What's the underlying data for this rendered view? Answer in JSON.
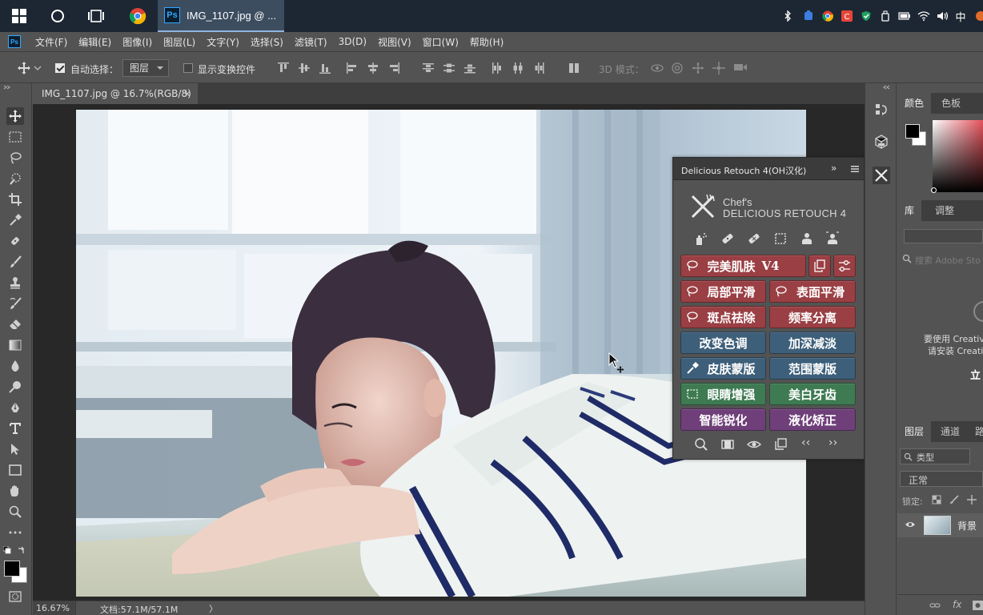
{
  "taskbar": {
    "ps_task_title": "IMG_1107.jpg @ ...",
    "ps_logo": "Ps",
    "ime_label": "中"
  },
  "menubar": {
    "logo": "Ps",
    "items": [
      "文件(F)",
      "编辑(E)",
      "图像(I)",
      "图层(L)",
      "文字(Y)",
      "选择(S)",
      "滤镜(T)",
      "3D(D)",
      "视图(V)",
      "窗口(W)",
      "帮助(H)"
    ]
  },
  "options": {
    "auto_select_label": "自动选择：",
    "auto_select_value": "图层",
    "show_transform_label": "显示变换控件",
    "mode_3d_label": "3D 模式："
  },
  "document": {
    "tab_title": "IMG_1107.jpg @ 16.7%(RGB/8)",
    "close_glyph": "×",
    "zoom": "16.67%",
    "doc_size": "文档:57.1M/57.1M",
    "status_arrow": "〉"
  },
  "plugin": {
    "title": "Delicious Retouch 4(OH汉化)",
    "expand_glyph": "»",
    "brand_line1": "Chef's",
    "brand_line2": "DELICIOUS RETOUCH 4",
    "buttons": {
      "perfect_skin": "完美肌肤",
      "perfect_skin_version": "V4",
      "local_smooth": "局部平滑",
      "surface_smooth": "表面平滑",
      "spot_remove": "斑点祛除",
      "freq_sep": "频率分离",
      "change_tone": "改变色调",
      "dodge_burn": "加深减淡",
      "skin_mask": "皮肤蒙版",
      "range_mask": "范围蒙版",
      "eye_enhance": "眼睛增强",
      "teeth_white": "美白牙齿",
      "smart_sharpen": "智能锐化",
      "liquify": "液化矫正"
    },
    "nav_prev": "‹‹",
    "nav_next": "››"
  },
  "rightdock": {
    "color_tab": "颜色",
    "swatches_tab": "色板",
    "library_tab": "库",
    "adjust_tab": "调整",
    "lib_search_placeholder": "搜索 Adobe Sto",
    "lib_msg1": "要使用 Creativ",
    "lib_msg2": "请安装 Creati",
    "lib_cta": "立",
    "layers_tab": "图层",
    "channels_tab": "通道",
    "paths_tab": "路",
    "kind_label": "类型",
    "blend_mode": "正常",
    "lock_label": "锁定:",
    "layer_name": "背景",
    "fx_label": "fx"
  },
  "colors": {
    "taskbar": "#1d2733",
    "ps_blue": "#31a8ff",
    "panel": "#535353",
    "btn_red": "#9a3f44",
    "btn_blue": "#3d5f7a",
    "btn_green": "#3e7a52",
    "btn_purple": "#6e3f78"
  }
}
